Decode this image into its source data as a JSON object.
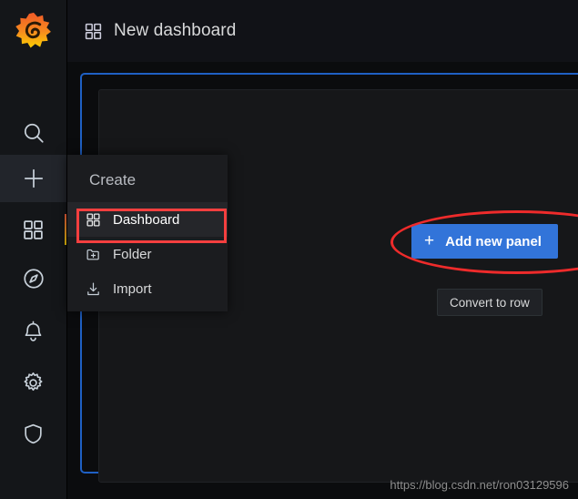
{
  "app": {
    "brand_icon": "grafana-logo",
    "brand_colors": {
      "outer": "#f2994a",
      "inner": "#f2c94c",
      "flame_top": "#f05a28"
    }
  },
  "sidebar": {
    "items": [
      {
        "label": "Search",
        "icon": "search-icon",
        "name": "sidebar-item-search",
        "active": false
      },
      {
        "label": "Create",
        "icon": "plus-icon",
        "name": "sidebar-item-create",
        "active": true
      },
      {
        "label": "Dashboards",
        "icon": "dashboards-grid-icon",
        "name": "sidebar-item-dashboards",
        "active": false,
        "accent": "#f55f3e"
      },
      {
        "label": "Explore",
        "icon": "compass-icon",
        "name": "sidebar-item-explore",
        "active": false
      },
      {
        "label": "Alerting",
        "icon": "bell-icon",
        "name": "sidebar-item-alerting",
        "active": false
      },
      {
        "label": "Configuration",
        "icon": "gear-icon",
        "name": "sidebar-item-configuration",
        "active": false
      },
      {
        "label": "Server Admin",
        "icon": "shield-icon",
        "name": "sidebar-item-server-admin",
        "active": false
      }
    ]
  },
  "header": {
    "icon": "dashboard-grid-icon",
    "title": "New dashboard"
  },
  "create_menu": {
    "header": "Create",
    "items": [
      {
        "label": "Dashboard",
        "icon": "grid-icon",
        "selected": true
      },
      {
        "label": "Folder",
        "icon": "folder-plus-icon",
        "selected": false
      },
      {
        "label": "Import",
        "icon": "import-download-icon",
        "selected": false
      }
    ]
  },
  "canvas": {
    "add_panel_button": {
      "label": "Add new panel",
      "icon": "plus-icon",
      "color": "#3274d9"
    },
    "convert_row_button": {
      "label": "Convert to row"
    },
    "dropzone_border_color": "#1f60c4"
  },
  "annotations": {
    "dashboard_box_color": "#f43f3f",
    "add_panel_ellipse_color": "#ee2b2b"
  },
  "watermark": {
    "text": "https://blog.csdn.net/ron03129596"
  }
}
